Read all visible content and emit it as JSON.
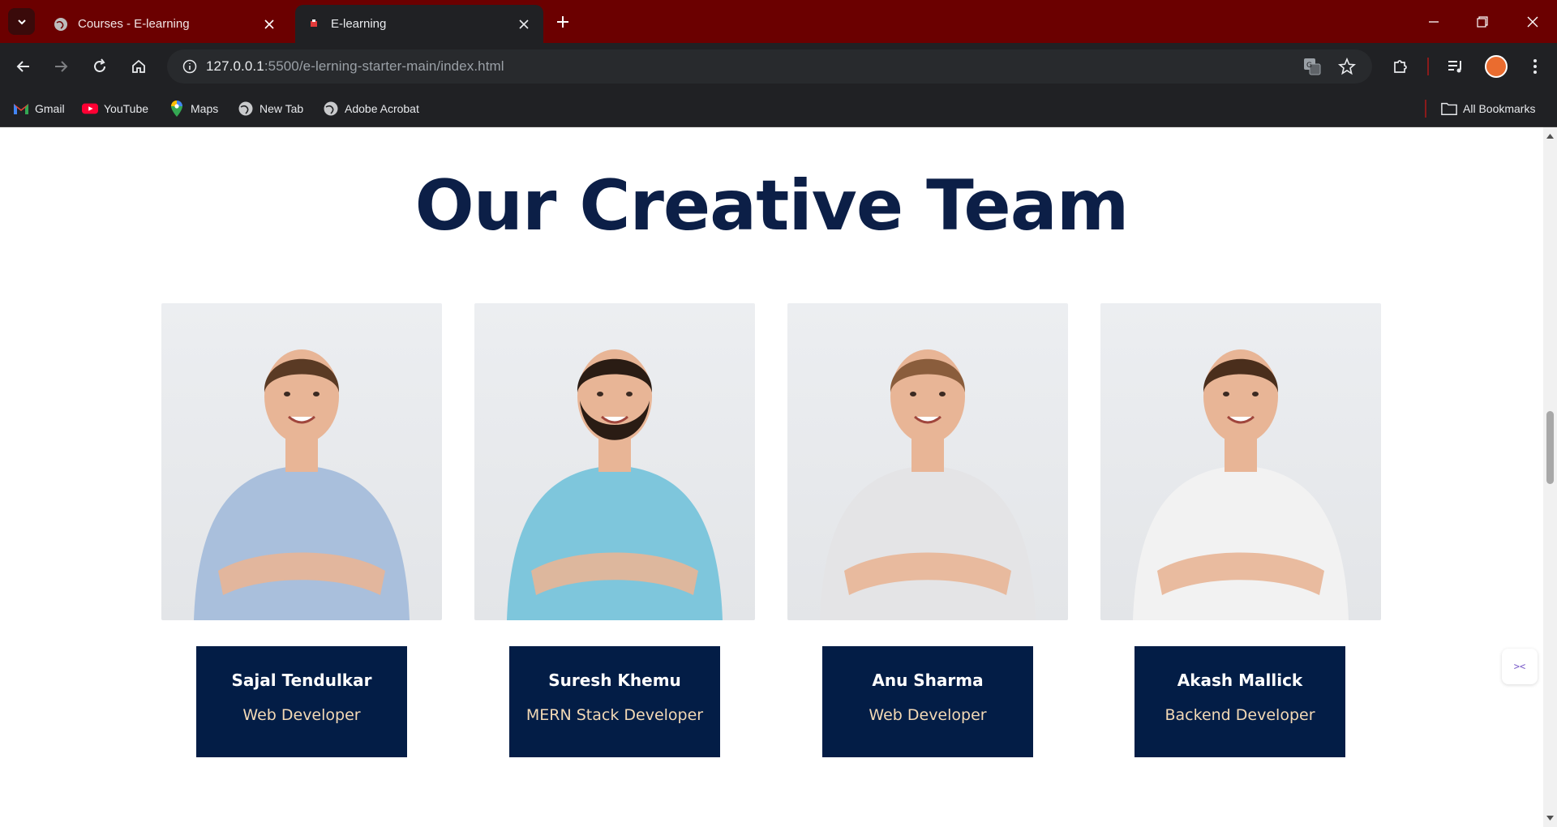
{
  "browser": {
    "tabs": [
      {
        "title": "Courses - E-learning",
        "active": false
      },
      {
        "title": "E-learning",
        "active": true
      }
    ],
    "url": {
      "host": "127.0.0.1",
      "path": ":5500/e-lerning-starter-main/index.html"
    },
    "bookmarks": [
      {
        "label": "Gmail",
        "icon": "gmail-icon"
      },
      {
        "label": "YouTube",
        "icon": "youtube-icon"
      },
      {
        "label": "Maps",
        "icon": "maps-icon"
      },
      {
        "label": "New Tab",
        "icon": "globe-icon"
      },
      {
        "label": "Adobe Acrobat",
        "icon": "globe-icon"
      }
    ],
    "all_bookmarks_label": "All Bookmarks",
    "colors": {
      "tabstrip": "#6b0000",
      "toolbar": "#202124"
    }
  },
  "team": {
    "heading": "Our Creative Team",
    "members": [
      {
        "name": "Sajal Tendulkar",
        "role": "Web Developer",
        "shirt": "#a9bfdc",
        "hair": "#5a3a24",
        "beard": false
      },
      {
        "name": "Suresh Khemu",
        "role": "MERN Stack Developer",
        "shirt": "#7ec6dc",
        "hair": "#2a1c14",
        "beard": true
      },
      {
        "name": "Anu Sharma",
        "role": "Web Developer",
        "shirt": "#e4e4e6",
        "hair": "#8a5d3c",
        "beard": false
      },
      {
        "name": "Akash Mallick",
        "role": "Backend Developer",
        "shirt": "#f2f2f2",
        "hair": "#4a2e1c",
        "beard": false
      }
    ],
    "colors": {
      "heading": "#0c1f47",
      "card": "#031d46",
      "role": "#f3d9b5"
    }
  }
}
